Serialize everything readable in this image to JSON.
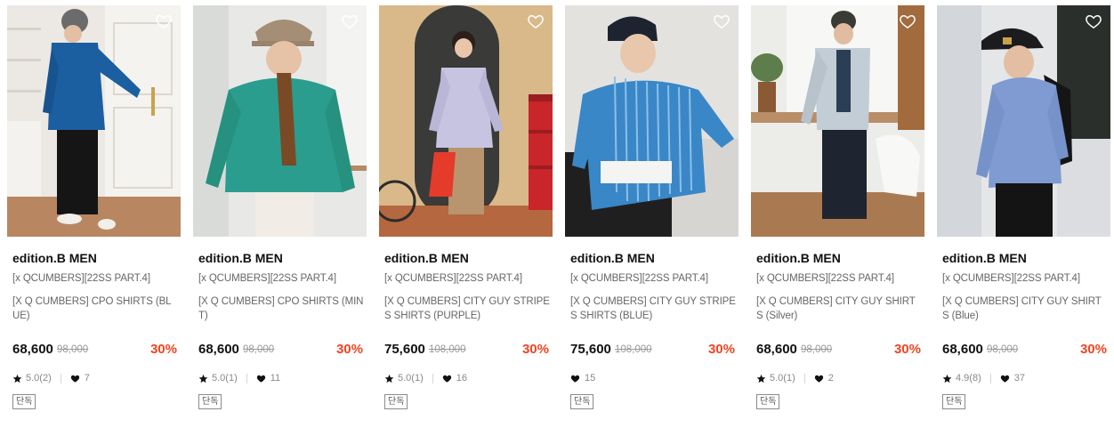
{
  "products": [
    {
      "brand": "edition.B MEN",
      "tagline": "[x QCUMBERS][22SS PART.4]",
      "name": "[X Q CUMBERS] CPO SHIRTS (BLUE)",
      "price": "68,600",
      "original_price": "98,000",
      "discount": "30%",
      "rating": "5.0(2)",
      "likes": "7",
      "badge": "단독",
      "wish_icon": "heart-outline-icon"
    },
    {
      "brand": "edition.B MEN",
      "tagline": "[x QCUMBERS][22SS PART.4]",
      "name": "[X Q CUMBERS] CPO SHIRTS (MINT)",
      "price": "68,600",
      "original_price": "98,000",
      "discount": "30%",
      "rating": "5.0(1)",
      "likes": "11",
      "badge": "단독",
      "wish_icon": "heart-outline-icon"
    },
    {
      "brand": "edition.B MEN",
      "tagline": "[x QCUMBERS][22SS PART.4]",
      "name": "[X Q CUMBERS] CITY GUY STRIPES SHIRTS (PURPLE)",
      "price": "75,600",
      "original_price": "108,000",
      "discount": "30%",
      "rating": "5.0(1)",
      "likes": "16",
      "badge": "단독",
      "wish_icon": "heart-outline-icon"
    },
    {
      "brand": "edition.B MEN",
      "tagline": "[x QCUMBERS][22SS PART.4]",
      "name": "[X Q CUMBERS] CITY GUY STRIPES SHIRTS (BLUE)",
      "price": "75,600",
      "original_price": "108,000",
      "discount": "30%",
      "rating": null,
      "likes": "15",
      "badge": "단독",
      "wish_icon": "heart-outline-icon"
    },
    {
      "brand": "edition.B MEN",
      "tagline": "[x QCUMBERS][22SS PART.4]",
      "name": "[X Q CUMBERS] CITY GUY SHIRTS (Silver)",
      "price": "68,600",
      "original_price": "98,000",
      "discount": "30%",
      "rating": "5.0(1)",
      "likes": "2",
      "badge": "단독",
      "wish_icon": "heart-outline-icon"
    },
    {
      "brand": "edition.B MEN",
      "tagline": "[x QCUMBERS][22SS PART.4]",
      "name": "[X Q CUMBERS] CITY GUY SHIRTS (Blue)",
      "price": "68,600",
      "original_price": "98,000",
      "discount": "30%",
      "rating": "4.9(8)",
      "likes": "37",
      "badge": "단독",
      "wish_icon": "heart-outline-icon"
    }
  ],
  "colors": {
    "discount": "#f1431e",
    "price": "#111111",
    "muted_text": "#666666",
    "strike_text": "#999999"
  },
  "icons": {
    "rating": "star-icon",
    "likes": "heart-filled-icon"
  }
}
